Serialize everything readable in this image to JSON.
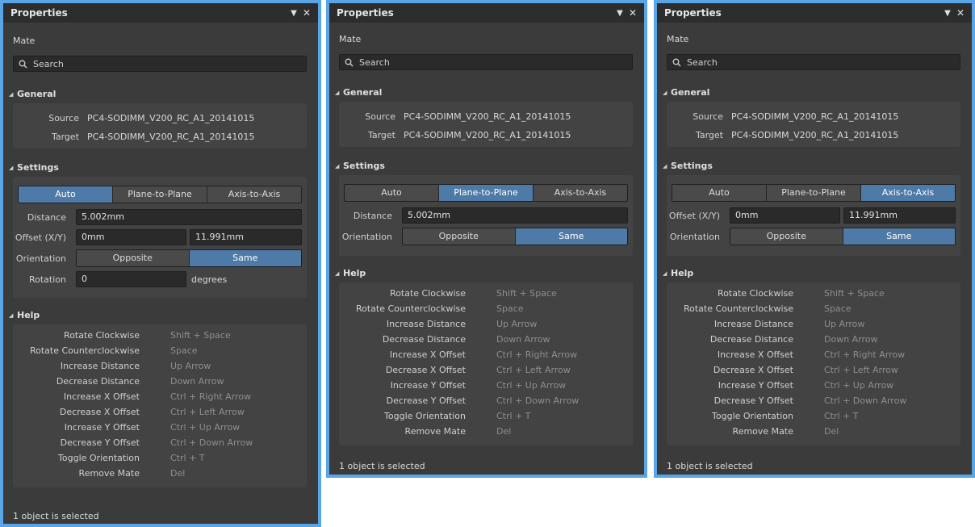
{
  "panels": [
    {
      "title": "Properties",
      "kind": "Mate",
      "search_placeholder": "Search",
      "general": {
        "header": "General",
        "source_label": "Source",
        "source_value": "PC4-SODIMM_V200_RC_A1_20141015",
        "target_label": "Target",
        "target_value": "PC4-SODIMM_V200_RC_A1_20141015"
      },
      "settings": {
        "header": "Settings",
        "modes": [
          "Auto",
          "Plane-to-Plane",
          "Axis-to-Axis"
        ],
        "active_mode": "Auto",
        "distance_label": "Distance",
        "distance_value": "5.002mm",
        "offset_label": "Offset (X/Y)",
        "offset_x": "0mm",
        "offset_y": "11.991mm",
        "orientation_label": "Orientation",
        "orientation_options": [
          "Opposite",
          "Same"
        ],
        "orientation_selected": "Same",
        "rotation_label": "Rotation",
        "rotation_value": "0",
        "rotation_unit": "degrees"
      },
      "help_header": "Help",
      "status": "1 object is selected"
    },
    {
      "title": "Properties",
      "kind": "Mate",
      "search_placeholder": "Search",
      "general": {
        "header": "General",
        "source_label": "Source",
        "source_value": "PC4-SODIMM_V200_RC_A1_20141015",
        "target_label": "Target",
        "target_value": "PC4-SODIMM_V200_RC_A1_20141015"
      },
      "settings": {
        "header": "Settings",
        "modes": [
          "Auto",
          "Plane-to-Plane",
          "Axis-to-Axis"
        ],
        "active_mode": "Plane-to-Plane",
        "distance_label": "Distance",
        "distance_value": "5.002mm",
        "orientation_label": "Orientation",
        "orientation_options": [
          "Opposite",
          "Same"
        ],
        "orientation_selected": "Same"
      },
      "help_header": "Help",
      "status": "1 object is selected"
    },
    {
      "title": "Properties",
      "kind": "Mate",
      "search_placeholder": "Search",
      "general": {
        "header": "General",
        "source_label": "Source",
        "source_value": "PC4-SODIMM_V200_RC_A1_20141015",
        "target_label": "Target",
        "target_value": "PC4-SODIMM_V200_RC_A1_20141015"
      },
      "settings": {
        "header": "Settings",
        "modes": [
          "Auto",
          "Plane-to-Plane",
          "Axis-to-Axis"
        ],
        "active_mode": "Axis-to-Axis",
        "offset_label": "Offset (X/Y)",
        "offset_x": "0mm",
        "offset_y": "11.991mm",
        "orientation_label": "Orientation",
        "orientation_options": [
          "Opposite",
          "Same"
        ],
        "orientation_selected": "Same"
      },
      "help_header": "Help",
      "status": "1 object is selected"
    }
  ],
  "help_items": [
    {
      "action": "Rotate Clockwise",
      "shortcut": "Shift + Space"
    },
    {
      "action": "Rotate Counterclockwise",
      "shortcut": "Space"
    },
    {
      "action": "Increase Distance",
      "shortcut": "Up Arrow"
    },
    {
      "action": "Decrease Distance",
      "shortcut": "Down Arrow"
    },
    {
      "action": "Increase X Offset",
      "shortcut": "Ctrl + Right Arrow"
    },
    {
      "action": "Decrease X Offset",
      "shortcut": "Ctrl + Left Arrow"
    },
    {
      "action": "Increase Y Offset",
      "shortcut": "Ctrl + Up Arrow"
    },
    {
      "action": "Decrease Y Offset",
      "shortcut": "Ctrl + Down Arrow"
    },
    {
      "action": "Toggle Orientation",
      "shortcut": "Ctrl + T"
    },
    {
      "action": "Remove Mate",
      "shortcut": "Del"
    }
  ]
}
